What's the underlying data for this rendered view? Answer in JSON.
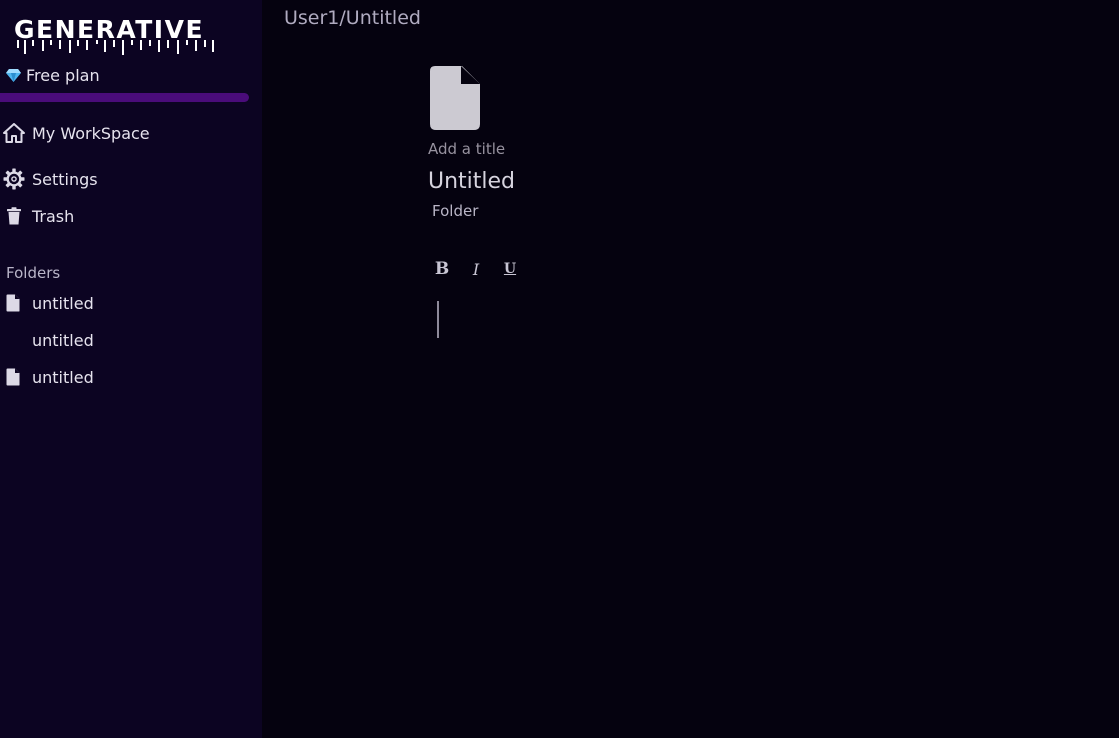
{
  "app": {
    "logo_text": "GENERATIVE"
  },
  "sidebar": {
    "plan_label": "Free plan",
    "plan_usage_fraction": 1.0,
    "nav": [
      {
        "label": "My WorkSpace",
        "icon": "home-icon"
      },
      {
        "label": "Settings",
        "icon": "gear-icon"
      },
      {
        "label": "Trash",
        "icon": "trash-icon"
      }
    ],
    "folders_heading": "Folders",
    "folders": [
      {
        "label": "untitled",
        "icon": "file-icon"
      },
      {
        "label": "untitled",
        "icon": ""
      },
      {
        "label": "untitled",
        "icon": "file-icon"
      }
    ]
  },
  "main": {
    "breadcrumb": "User1/Untitled",
    "add_title_label": "Add a title",
    "doc_title": "Untitled",
    "doc_folder": "Folder",
    "toolbar": {
      "bold": "B",
      "italic": "I",
      "underline": "U"
    }
  },
  "colors": {
    "sidebar_bg": "#0c0422",
    "main_bg": "#05020f",
    "accent": "#4a0c7a"
  }
}
